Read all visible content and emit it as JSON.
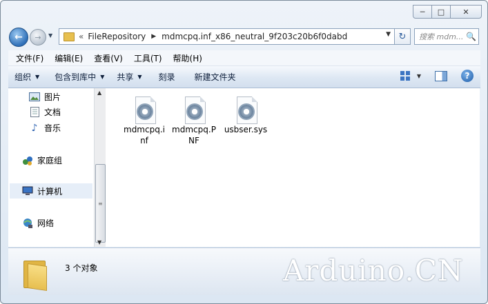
{
  "window": {
    "caption_buttons": {
      "minimize_icon": "minimize-icon",
      "maximize_icon": "maximize-icon",
      "close_icon": "close-icon"
    }
  },
  "nav": {
    "back_icon": "back-arrow-icon",
    "forward_icon": "forward-arrow-icon",
    "breadcrumb": [
      "FileRepository",
      "mdmcpq.inf_x86_neutral_9f203c20b6f0dabd"
    ],
    "search_placeholder": "搜索 mdm..."
  },
  "menu": [
    "文件(F)",
    "编辑(E)",
    "查看(V)",
    "工具(T)",
    "帮助(H)"
  ],
  "commands": {
    "organize": "组织",
    "include_in_library": "包含到库中",
    "share": "共享",
    "burn": "刻录",
    "new_folder": "新建文件夹"
  },
  "navpane": {
    "items": [
      {
        "label": "图片",
        "icon": "pictures-icon"
      },
      {
        "label": "文档",
        "icon": "documents-icon"
      },
      {
        "label": "音乐",
        "icon": "music-icon"
      },
      {
        "label": "家庭组",
        "icon": "homegroup-icon"
      },
      {
        "label": "计算机",
        "icon": "computer-icon"
      },
      {
        "label": "网络",
        "icon": "network-icon"
      }
    ]
  },
  "files": [
    {
      "name_line1": "mdmcpq.i",
      "name_line2": "nf"
    },
    {
      "name_line1": "mdmcpq.P",
      "name_line2": "NF"
    },
    {
      "name_line1": "usbser.sys",
      "name_line2": ""
    }
  ],
  "status": {
    "count_text": "3 个对象"
  },
  "watermark": "Arduino.CN",
  "colors": {
    "accent": "#3d75c2",
    "folder": "#e7bf50",
    "selected_bg": "#e6eef8"
  }
}
